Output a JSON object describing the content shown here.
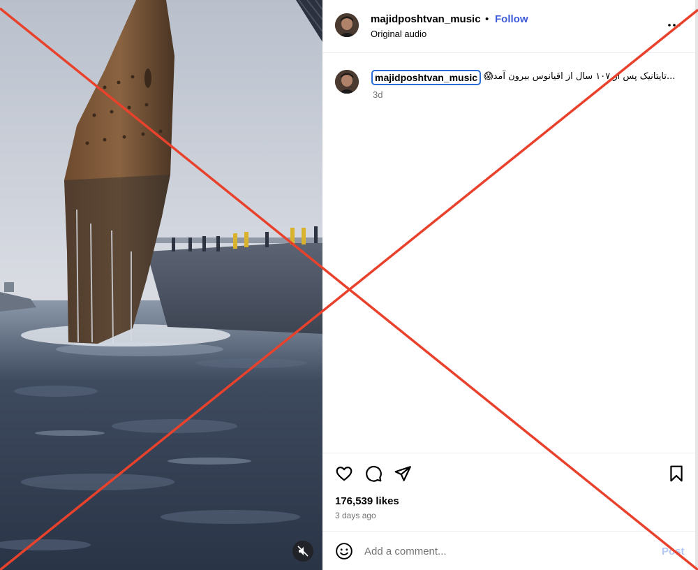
{
  "post": {
    "username": "majidposhtvan_music",
    "separator": "•",
    "follow_label": "Follow",
    "audio_label": "Original audio",
    "caption_user": "majidposhtvan_music",
    "caption_text": "😱تایتانیک پس از ۱۰۷ سال از اقیانوس بیرون آمد...",
    "caption_time": "3d",
    "likes": "176,539 likes",
    "posted_date": "3 days ago"
  },
  "comment": {
    "placeholder": "Add a comment...",
    "post_label": "Post"
  },
  "icons": {
    "more": "more-options-icon",
    "like": "heart-icon",
    "comment": "comment-bubble-icon",
    "share": "paper-plane-icon",
    "save": "bookmark-icon",
    "emoji": "emoji-smile-icon",
    "mute": "speaker-muted-icon"
  },
  "colors": {
    "follow": "#3f5bd8",
    "post_disabled": "#b3c8f5",
    "overlay_x": "#e8412c",
    "selection_outline": "#2b6cd6"
  }
}
